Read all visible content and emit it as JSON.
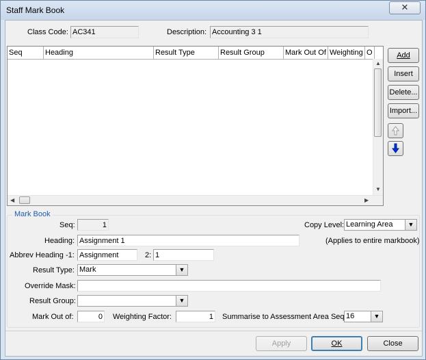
{
  "window": {
    "title": "Staff Mark Book",
    "close_glyph": "✕"
  },
  "header": {
    "class_code_label": "Class Code:",
    "class_code_value": "AC341",
    "description_label": "Description:",
    "description_value": "Accounting 3 1"
  },
  "grid": {
    "columns": [
      "Seq",
      "Heading",
      "Result Type",
      "Result Group",
      "Mark Out Of",
      "Weighting",
      "O"
    ],
    "rows": []
  },
  "side_buttons": {
    "add": "Add",
    "insert": "Insert",
    "delete": "Delete...",
    "import": "Import...",
    "up_icon": "arrow-up-icon",
    "down_icon": "arrow-down-icon"
  },
  "markbook": {
    "group_title": "Mark Book",
    "seq_label": "Seq:",
    "seq_value": "1",
    "copy_level_label": "Copy Level:",
    "copy_level_value": "Learning Area",
    "copy_level_note": "(Applies to entire markbook)",
    "heading_label": "Heading:",
    "heading_value": "Assignment 1",
    "abbrev_label": "Abbrev Heading -1:",
    "abbrev1_value": "Assignment",
    "abbrev2_label": "2:",
    "abbrev2_value": "1",
    "result_type_label": "Result Type:",
    "result_type_value": "Mark",
    "override_mask_label": "Override Mask:",
    "override_mask_value": "",
    "result_group_label": "Result Group:",
    "result_group_value": "",
    "mark_out_of_label": "Mark Out of:",
    "mark_out_of_value": "0",
    "weighting_label": "Weighting Factor:",
    "weighting_value": "1",
    "summarise_label": "Summarise to Assessment Area Seq:",
    "summarise_value": "16"
  },
  "footer": {
    "apply": "Apply",
    "ok": "OK",
    "close": "Close"
  },
  "colors": {
    "group_title": "#1f5ca8",
    "down_arrow": "#0033cc"
  }
}
